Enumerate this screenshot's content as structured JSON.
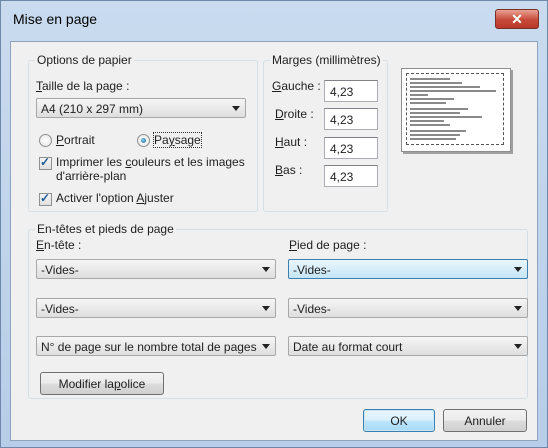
{
  "window": {
    "title": "Mise en page",
    "close_glyph": "✕"
  },
  "paper": {
    "legend": "Options de papier",
    "size_label_pre": "",
    "size_label_ul": "T",
    "size_label_post": "aille de la page :",
    "size_value": "A4 (210 x 297 mm)",
    "portrait_ul": "P",
    "portrait_post": "ortrait",
    "landscape_ul": "",
    "landscape_pre": "Pa",
    "landscape_u2": "y",
    "landscape_post": "sage",
    "orientation_selected": "Paysage",
    "print_colors_pre": "Imprimer les ",
    "print_colors_ul": "c",
    "print_colors_mid": "ouleurs et les images",
    "print_colors_line2": "d'arrière-plan",
    "print_colors_checked": true,
    "fit_pre": "Activer l'option ",
    "fit_ul": "A",
    "fit_post": "juster",
    "fit_checked": true
  },
  "margins": {
    "legend": "Marges (millimètres)",
    "left_ul": "G",
    "left_post": "auche :",
    "left_value": "4,23",
    "right_ul": "D",
    "right_post": "roite :",
    "right_value": "4,23",
    "top_ul": "H",
    "top_post": "aut :",
    "top_value": "4,23",
    "bottom_ul": "B",
    "bottom_post": "as :",
    "bottom_value": "4,23"
  },
  "headers_footers": {
    "legend": "En-têtes et pieds de page",
    "header_ul": "E",
    "header_post": "n-tête :",
    "footer_ul": "P",
    "footer_post": "ied de page :",
    "header_1": "-Vides-",
    "header_2": "-Vides-",
    "header_3": "N° de page sur le nombre total de pages",
    "footer_1": "-Vides-",
    "footer_2": "-Vides-",
    "footer_3": "Date au format court",
    "font_button_pre": "Modifier la ",
    "font_button_ul": "p",
    "font_button_post": "olice"
  },
  "buttons": {
    "ok": "OK",
    "cancel": "Annuler"
  }
}
